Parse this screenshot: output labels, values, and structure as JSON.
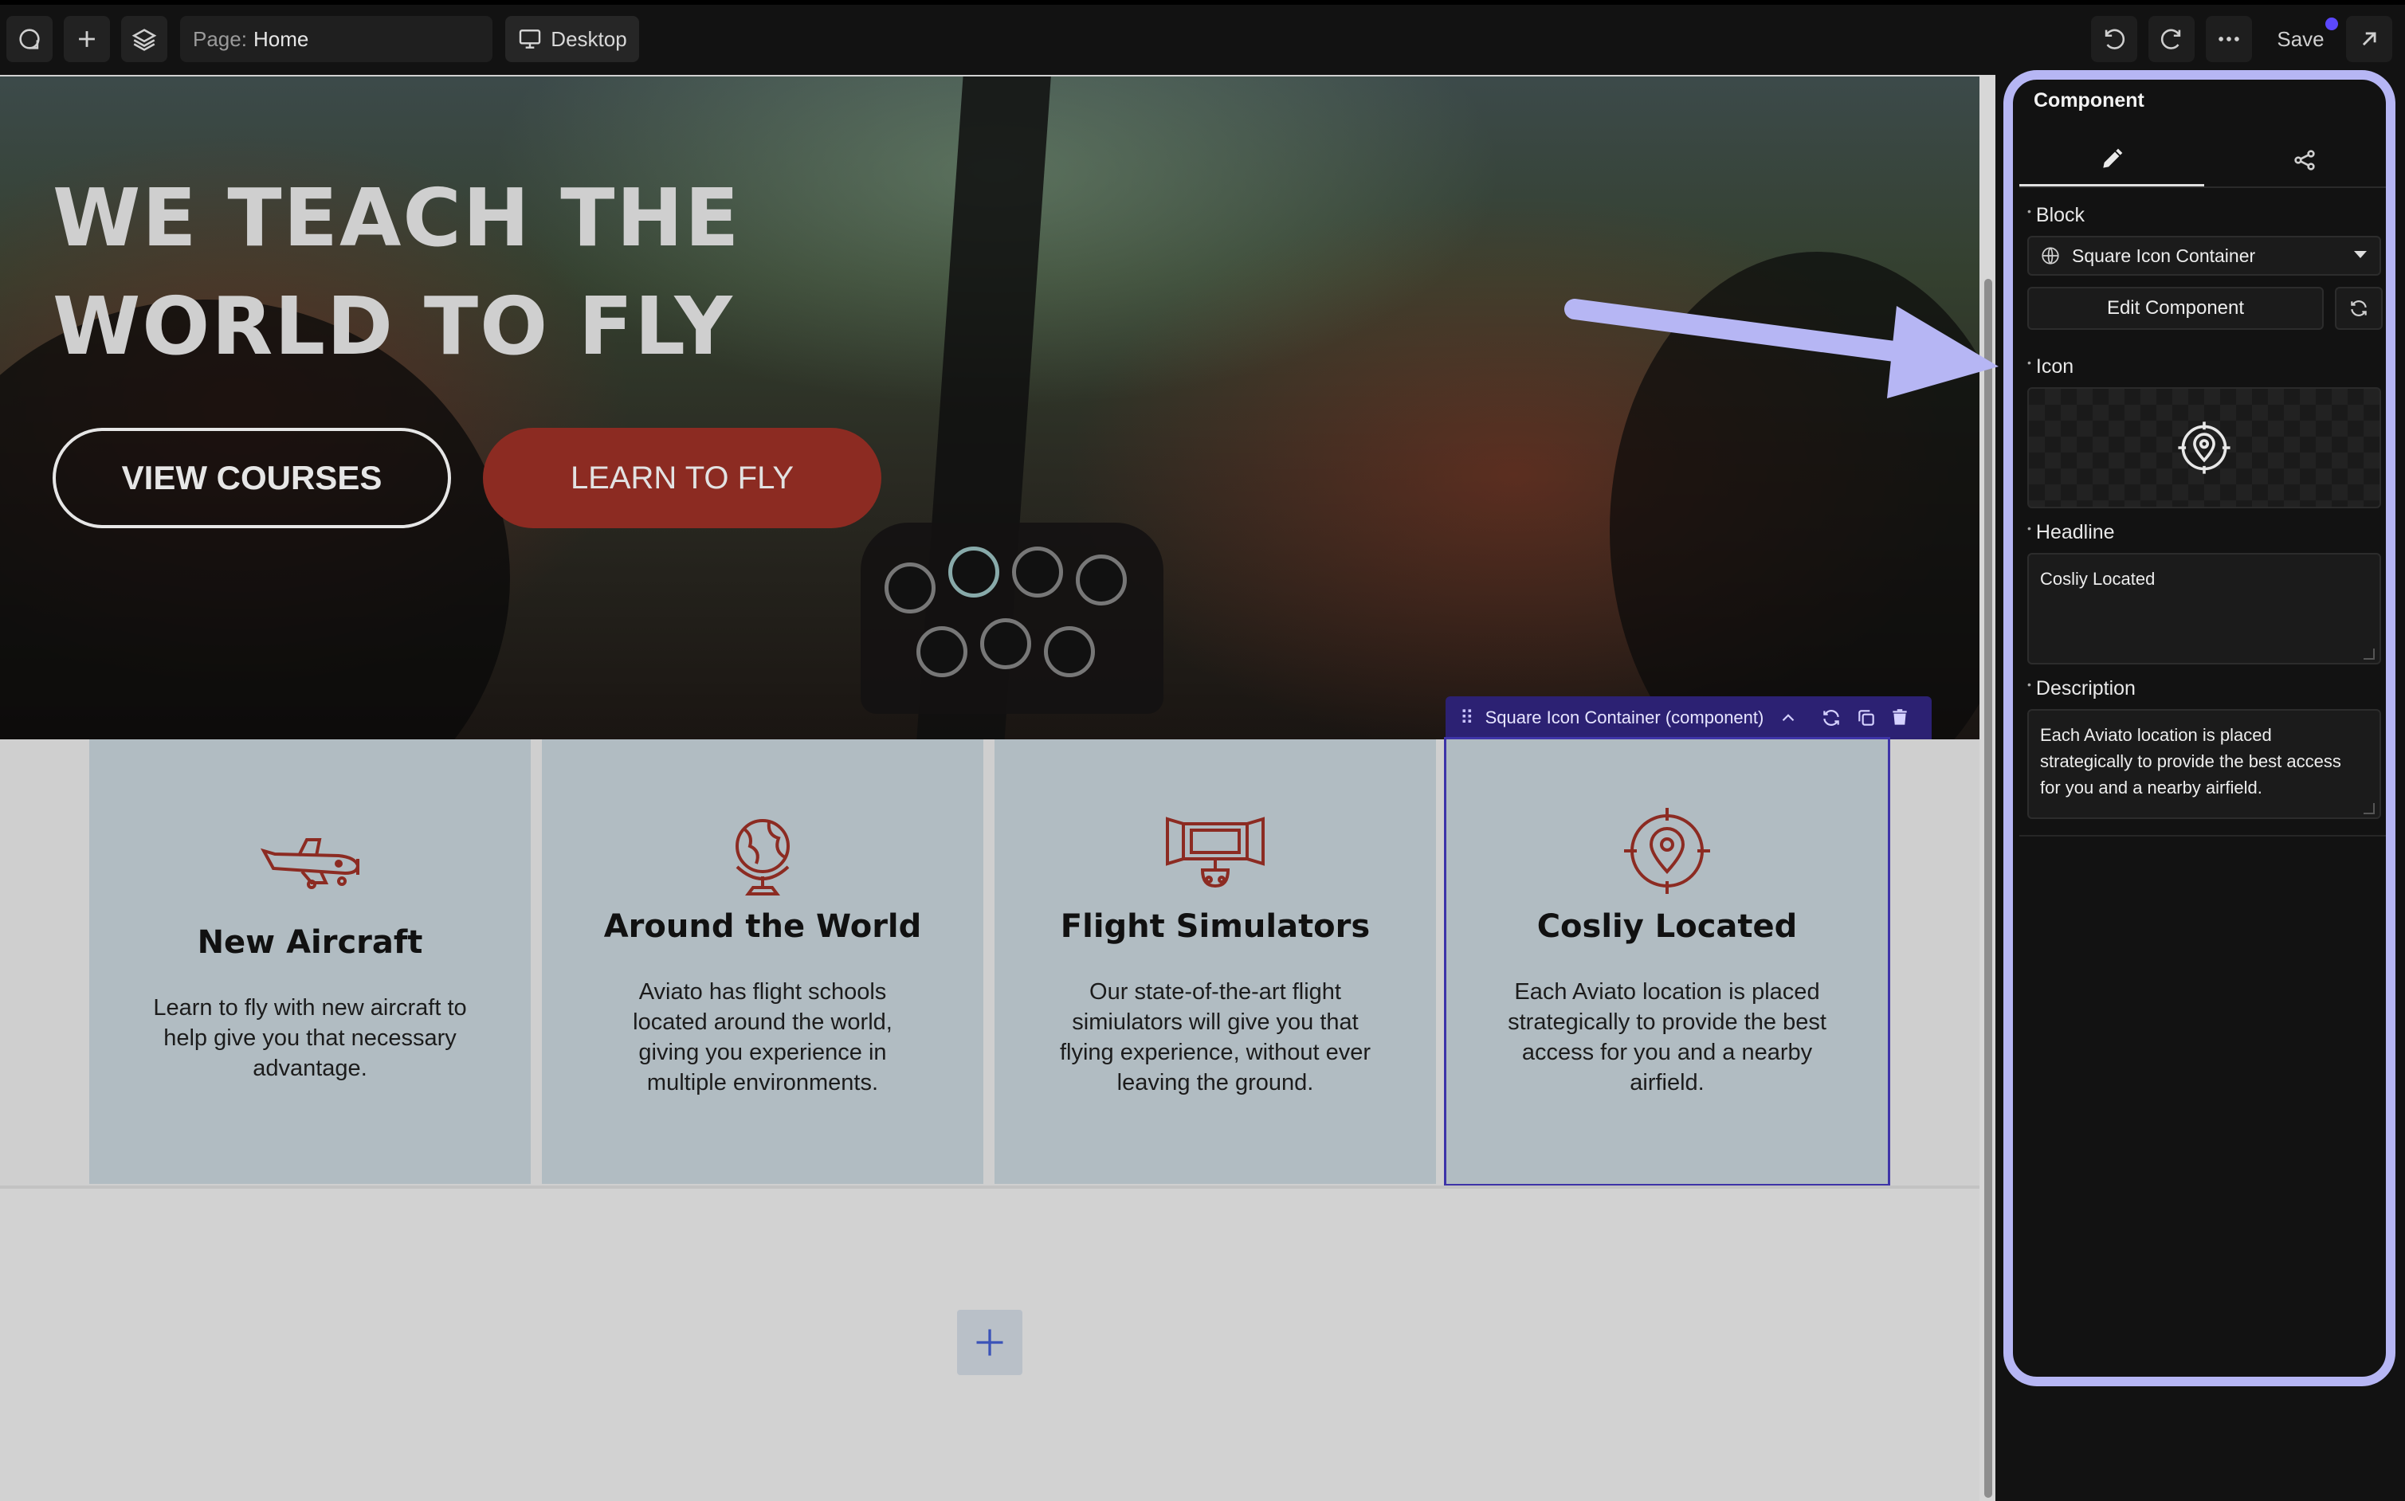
{
  "toolbar": {
    "page_label": "Page:",
    "page_value": "Home",
    "device": "Desktop",
    "save": "Save",
    "icons": [
      "logo-icon",
      "plus-icon",
      "layers-icon",
      "monitor-icon",
      "undo-icon",
      "redo-icon",
      "more-icon",
      "external-link-icon"
    ]
  },
  "hero": {
    "title_line1": "WE TEACH THE",
    "title_line2": "WORLD TO FLY",
    "btn_primary": "VIEW COURSES",
    "btn_secondary": "LEARN TO FLY"
  },
  "component_toolbar": {
    "label": "Square Icon Container (component)"
  },
  "cards": [
    {
      "icon": "airplane-icon",
      "title": "New Aircraft",
      "text_lines": [
        "Learn to fly with new aircraft to",
        "help give you that necessary",
        "advantage."
      ]
    },
    {
      "icon": "globe-icon",
      "title": "Around the World",
      "text_lines": [
        "Aviato has flight schools",
        "located around the world,",
        "giving you experience in",
        "multiple environments."
      ]
    },
    {
      "icon": "simulator-icon",
      "title": "Flight Simulators",
      "text_lines": [
        "Our state-of-the-art flight",
        "simiulators will give you that",
        "flying experience, without ever",
        "leaving the ground."
      ]
    },
    {
      "icon": "location-target-icon",
      "title": "Cosliy Located",
      "text_lines": [
        "Each Aviato location is placed",
        "strategically to provide the best",
        "access for you and a nearby",
        "airfield."
      ]
    }
  ],
  "panel": {
    "title": "Component",
    "tabs": [
      "edit-tab",
      "share-tab"
    ],
    "block_label": "Block",
    "block_value": "Square Icon Container",
    "edit_component": "Edit Component",
    "icon_label": "Icon",
    "headline_label": "Headline",
    "headline_value": "Cosliy Located",
    "description_label": "Description",
    "description_lines": [
      "Each Aviato location is placed",
      "strategically to provide the best access",
      "for you and a nearby airfield."
    ]
  },
  "colors": {
    "accent": "#8c2b22",
    "card_bg": "#b1bcc2",
    "selection": "#2c2173",
    "annotation": "#b6b6f4"
  }
}
